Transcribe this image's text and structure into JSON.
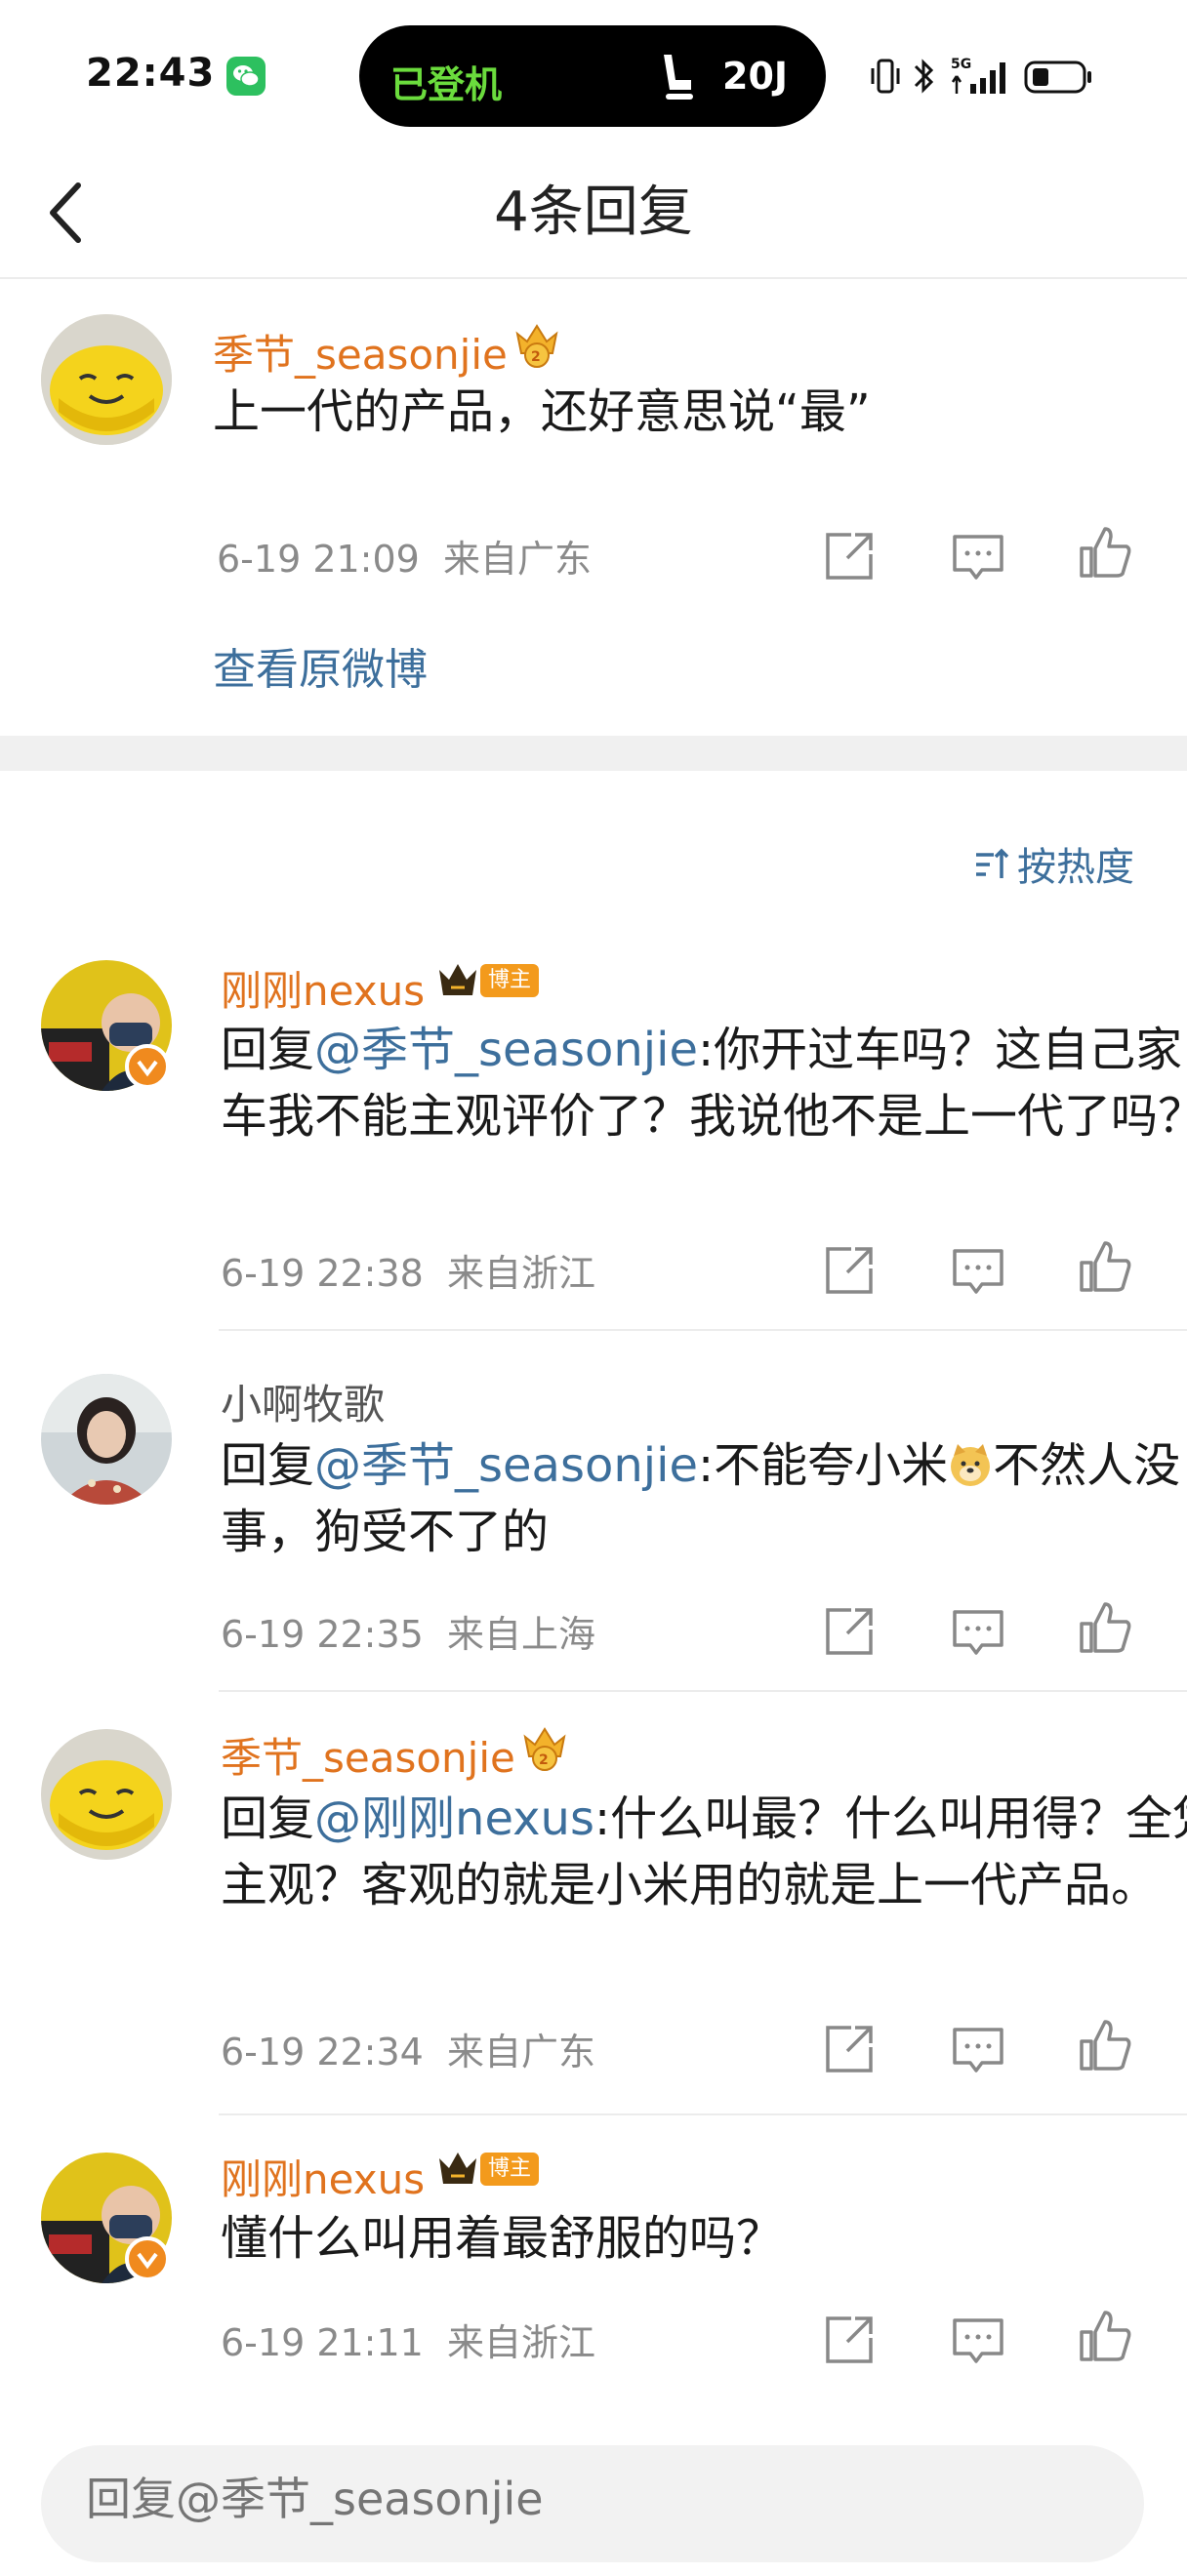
{
  "status_bar": {
    "time": "22:43",
    "island_status": "已登机",
    "island_seat": "20J",
    "network": "5G",
    "icons": [
      "wechat-icon",
      "seat-icon",
      "vibrate-icon",
      "bluetooth-icon",
      "signal-icon",
      "battery-icon"
    ]
  },
  "nav": {
    "title": "4条回复",
    "back_icon": "chevron-left-icon"
  },
  "original": {
    "user": "季节_seasonjie",
    "text": "上一代的产品，还好意思说“最”",
    "time": "6-19 21:09",
    "location": "来自广东",
    "view_original": "查看原微博"
  },
  "sort_label": "按热度",
  "replies": [
    {
      "user": "刚刚nexus",
      "badge": "博主",
      "prefix": "回复",
      "mention": "@季节_seasonjie",
      "rest": ":你开过车吗？这自己家车我不能主观评价了？我说他不是上一代了吗？",
      "time": "6-19 22:38",
      "location": "来自浙江"
    },
    {
      "user": "小啊牧歌",
      "prefix": "回复",
      "mention": "@季节_seasonjie",
      "rest": ":不能夸小米",
      "rest2": "不然人没事，狗受不了的",
      "time": "6-19 22:35",
      "location": "来自上海"
    },
    {
      "user": "季节_seasonjie",
      "prefix": "回复",
      "mention": "@刚刚nexus",
      "rest": ":什么叫最？什么叫用得？全凭主观？客观的就是小米用的就是上一代产品。",
      "time": "6-19 22:34",
      "location": "来自广东"
    },
    {
      "user": "刚刚nexus",
      "badge": "博主",
      "text": "懂什么叫用着最舒服的吗？",
      "time": "6-19 21:11",
      "location": "来自浙江"
    }
  ],
  "reply_input": {
    "placeholder": "回复@季节_seasonjie"
  },
  "colors": {
    "username": "#e0731e",
    "link": "#3d6f9c",
    "meta": "#8a8a8a",
    "badge": "#f39a1c"
  }
}
